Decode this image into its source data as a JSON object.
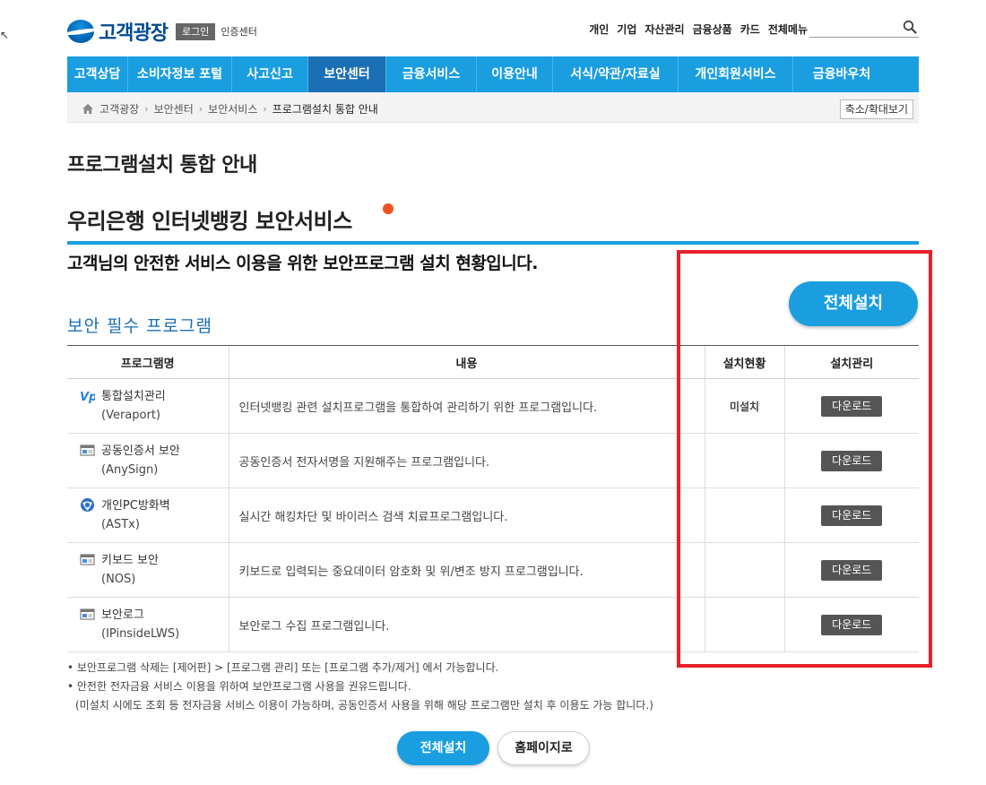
{
  "header": {
    "logo_text": "고객광장",
    "login_label": "로그인",
    "cert_label": "인증센터",
    "top_nav": [
      "개인",
      "기업",
      "자산관리",
      "금융상품",
      "카드",
      "전체메뉴"
    ]
  },
  "main_nav": {
    "items": [
      "고객상담",
      "소비자정보 포털",
      "사고신고",
      "보안센터",
      "금융서비스",
      "이용안내",
      "서식/약관/자료실",
      "개인회원서비스",
      "금융바우처"
    ],
    "active": "보안센터"
  },
  "breadcrumb": {
    "items": [
      "고객광장",
      "보안센터",
      "보안서비스",
      "프로그램설치 통합 안내"
    ],
    "zoom_label": "축소/확대보기"
  },
  "page": {
    "title": "프로그램설치 통합 안내",
    "section_title": "우리은행 인터넷뱅킹 보안서비스",
    "subtitle": "고객님의 안전한 서비스 이용을 위한 보안프로그램 설치 현황입니다.",
    "install_all_label": "전체설치",
    "required_title": "보안 필수 프로그램"
  },
  "table": {
    "headers": [
      "프로그램명",
      "내용",
      "설치현황",
      "설치관리"
    ],
    "rows": [
      {
        "name": "통합설치관리",
        "name_en": "(Veraport)",
        "desc": "인터넷뱅킹 관련 설치프로그램을 통합하여 관리하기 위한 프로그램입니다.",
        "status": "미설치",
        "action": "다운로드",
        "icon": "veraport-icon"
      },
      {
        "name": "공동인증서 보안",
        "name_en": "(AnySign)",
        "desc": "공동인증서 전자서명을 지원해주는 프로그램입니다.",
        "status": "",
        "action": "다운로드",
        "icon": "program-window-icon"
      },
      {
        "name": "개인PC방화벽",
        "name_en": "(ASTx)",
        "desc": "실시간 해킹차단 및 바이러스 검색 치료프로그램입니다.",
        "status": "",
        "action": "다운로드",
        "icon": "globe-shield-icon"
      },
      {
        "name": "키보드 보안",
        "name_en": "(NOS)",
        "desc": "키보드로 입력되는 중요데이터 암호화 및 위/변조 방지 프로그램입니다.",
        "status": "",
        "action": "다운로드",
        "icon": "program-window-icon"
      },
      {
        "name": "보안로그",
        "name_en": "(IPinsideLWS)",
        "desc": "보안로그 수집 프로그램입니다.",
        "status": "",
        "action": "다운로드",
        "icon": "program-window-icon"
      }
    ]
  },
  "notes": [
    "• 보안프로그램 삭제는 [제어판] > [프로그램 관리] 또는 [프로그램 추가/제거] 에서 가능합니다.",
    "• 안전한 전자금융 서비스 이용을 위하여 보안프로그램 사용을 권유드립니다.",
    "(미설치 시에도 조회 등 전자금융 서비스 이용이 가능하며, 공동인증서 사용을 위해 해당 프로그램만 설치 후 이용도 가능 합니다.)"
  ],
  "bottom_buttons": {
    "install_all": "전체설치",
    "home": "홈페이지로"
  },
  "colors": {
    "accent": "#1a9ee0",
    "nav_active": "#1a6fb5",
    "highlight": "#e8202a",
    "dot": "#f0521e"
  }
}
